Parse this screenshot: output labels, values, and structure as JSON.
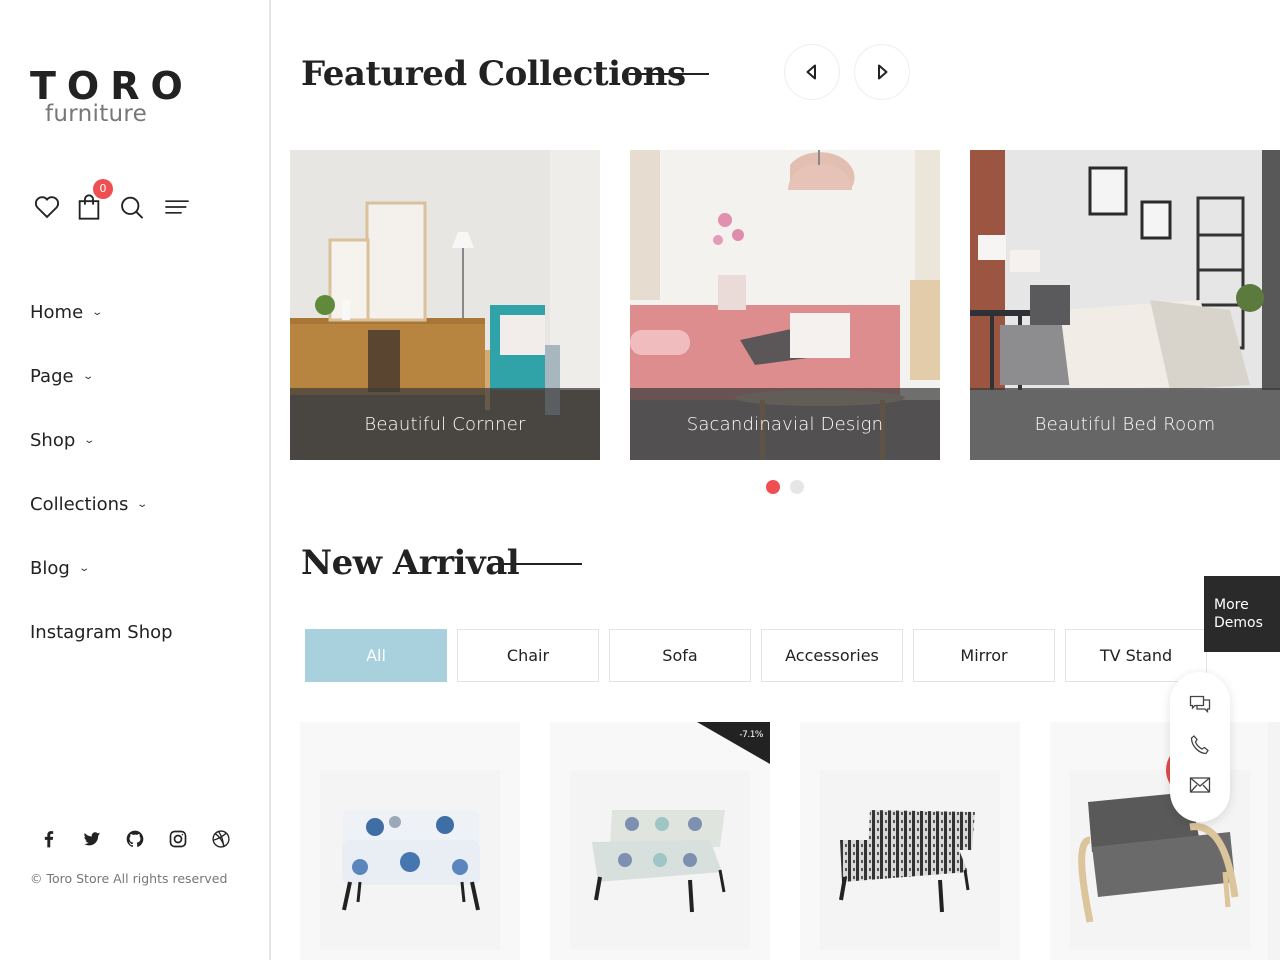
{
  "brand": {
    "name": "TORO",
    "tagline": "furniture"
  },
  "header_icons": {
    "wishlist": "heart-icon",
    "cart": "shopping-bag-icon",
    "cart_count": "0",
    "search": "search-icon",
    "menu": "menu-icon"
  },
  "nav": [
    {
      "label": "Home",
      "has_dropdown": true
    },
    {
      "label": "Page",
      "has_dropdown": true
    },
    {
      "label": "Shop",
      "has_dropdown": true
    },
    {
      "label": "Collections",
      "has_dropdown": true
    },
    {
      "label": "Blog",
      "has_dropdown": true
    },
    {
      "label": "Instagram Shop",
      "has_dropdown": false
    }
  ],
  "nav_chevron": "⌄",
  "social": [
    "facebook-icon",
    "twitter-icon",
    "github-icon",
    "instagram-icon",
    "dribbble-icon"
  ],
  "copyright": "© Toro Store All rights reserved",
  "featured": {
    "title": "Featured Collections",
    "prev_label": "previous",
    "next_label": "next",
    "items": [
      {
        "caption": "Beautiful Cornner"
      },
      {
        "caption": "Sacandinavial Design"
      },
      {
        "caption": "Beautiful Bed Room"
      }
    ],
    "pagination": {
      "pages": 2,
      "active": 1
    }
  },
  "new_arrival": {
    "title": "New Arrival",
    "filters": [
      {
        "label": "All",
        "active": true
      },
      {
        "label": "Chair",
        "active": false
      },
      {
        "label": "Sofa",
        "active": false
      },
      {
        "label": "Accessories",
        "active": false
      },
      {
        "label": "Mirror",
        "active": false
      },
      {
        "label": "TV Stand",
        "active": false
      }
    ],
    "products": [
      {
        "name": "Blue floral loveseat",
        "badge": null
      },
      {
        "name": "Pale floral loveseat",
        "badge": "-7.1%"
      },
      {
        "name": "Black and white pattern loveseat",
        "badge": null
      },
      {
        "name": "Grey bentwood loveseat",
        "badge": null
      }
    ]
  },
  "floating": {
    "more_demos_line1": "More",
    "more_demos_line2": "Demos",
    "contact": [
      "chat-icon",
      "phone-icon",
      "mail-icon"
    ]
  },
  "colors": {
    "accent_red": "#ef4f51",
    "filter_active": "#a9d0dd",
    "dark": "#222222"
  }
}
